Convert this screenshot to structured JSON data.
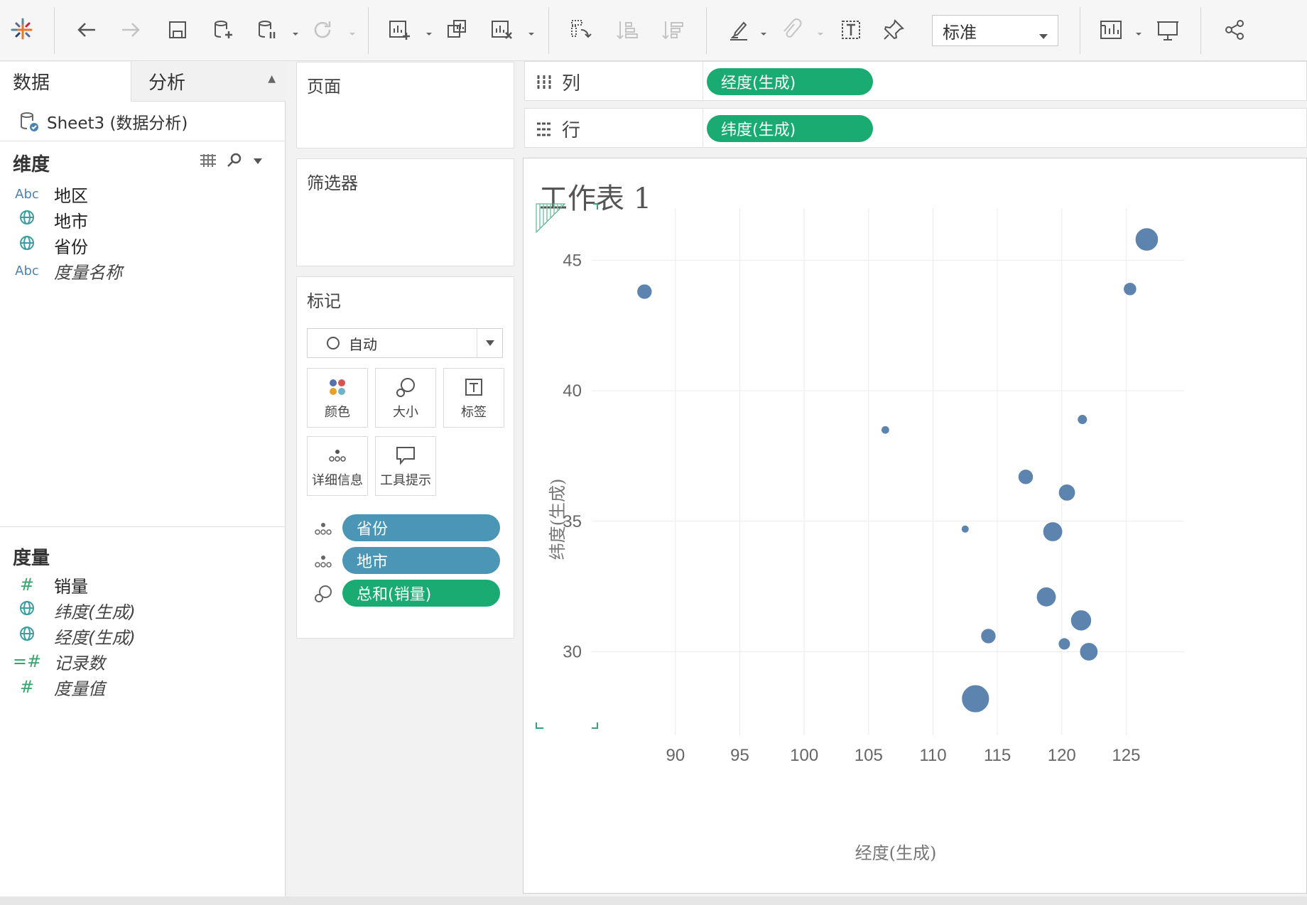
{
  "toolbar": {
    "fit_select": "标准"
  },
  "data_pane": {
    "tab_data": "数据",
    "tab_analysis": "分析",
    "datasource": "Sheet3 (数据分析)",
    "dimensions_title": "维度",
    "dimensions": [
      {
        "type": "Abc",
        "name": "地区"
      },
      {
        "type": "geo",
        "name": "地市"
      },
      {
        "type": "geo",
        "name": "省份"
      },
      {
        "type": "Abc",
        "name": "度量名称"
      }
    ],
    "measures_title": "度量",
    "measures": [
      {
        "type": "#",
        "name": "销量"
      },
      {
        "type": "geo",
        "name": "纬度(生成)"
      },
      {
        "type": "geo",
        "name": "经度(生成)"
      },
      {
        "type": "=#",
        "name": "记录数"
      },
      {
        "type": "#",
        "name": "度量值"
      }
    ]
  },
  "cards": {
    "pages_title": "页面",
    "filters_title": "筛选器",
    "marks_title": "标记",
    "mark_type": "自动",
    "buttons": {
      "color": "颜色",
      "size": "大小",
      "label": "标签",
      "detail": "详细信息",
      "tooltip": "工具提示"
    },
    "pills": [
      {
        "name": "省份"
      },
      {
        "name": "地市"
      },
      {
        "name": "总和(销量)"
      }
    ]
  },
  "shelves": {
    "columns_label": "列",
    "columns_pill": "经度(生成)",
    "rows_label": "行",
    "rows_pill": "纬度(生成)"
  },
  "view": {
    "title": "工作表 1"
  },
  "chart_data": {
    "type": "scatter",
    "title": "工作表 1",
    "xlabel": "经度(生成)",
    "ylabel": "纬度(生成)",
    "xlim": [
      83.5,
      129.5
    ],
    "ylim": [
      26.8,
      47.0
    ],
    "xticks": [
      90,
      95,
      100,
      105,
      110,
      115,
      120,
      125
    ],
    "yticks": [
      30,
      35,
      40,
      45
    ],
    "grid": true,
    "size_encoding": "总和(销量)",
    "color": "#4e79a7",
    "points": [
      {
        "x": 87.6,
        "y": 43.8,
        "s": 3
      },
      {
        "x": 126.6,
        "y": 45.8,
        "s": 9
      },
      {
        "x": 125.3,
        "y": 43.9,
        "s": 2
      },
      {
        "x": 106.3,
        "y": 38.5,
        "s": 0.4
      },
      {
        "x": 121.6,
        "y": 38.9,
        "s": 0.8
      },
      {
        "x": 117.2,
        "y": 36.7,
        "s": 3
      },
      {
        "x": 120.4,
        "y": 36.1,
        "s": 4
      },
      {
        "x": 112.5,
        "y": 34.7,
        "s": 0.3
      },
      {
        "x": 119.3,
        "y": 34.6,
        "s": 6
      },
      {
        "x": 118.8,
        "y": 32.1,
        "s": 6
      },
      {
        "x": 121.5,
        "y": 31.2,
        "s": 7
      },
      {
        "x": 114.3,
        "y": 30.6,
        "s": 3
      },
      {
        "x": 120.2,
        "y": 30.3,
        "s": 1.5
      },
      {
        "x": 122.1,
        "y": 30.0,
        "s": 5
      },
      {
        "x": 113.3,
        "y": 28.2,
        "s": 14
      }
    ]
  }
}
